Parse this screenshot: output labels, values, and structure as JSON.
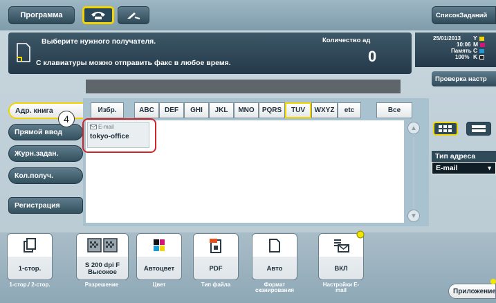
{
  "topbar": {
    "program_tab": "Программа",
    "job_list_tab": "СписокЗаданий"
  },
  "message": {
    "line1": "Выберите нужного получателя.",
    "line2": "С клавиатуры можно отправить факс в любое время.",
    "count_label": "Количество ад",
    "count_value": "0"
  },
  "status": {
    "date": "25/01/2013",
    "time": "10:06",
    "memory_label": "Память",
    "memory_value": "100%",
    "toner_letters": [
      "Y",
      "M",
      "C",
      "K"
    ],
    "toner_colors": [
      "#f2d400",
      "#d3157a",
      "#1c9ad6",
      "#222222"
    ]
  },
  "check_settings_button": "Проверка настр",
  "left_menu": {
    "address_book": "Адр. книга",
    "direct_input": "Прямой ввод",
    "job_log": "Журн.задан.",
    "multiple_dest": "Кол.получ.",
    "registration": "Регистрация"
  },
  "index_tabs": [
    "Избр.",
    "ABC",
    "DEF",
    "GHI",
    "JKL",
    "MNO",
    "PQRS",
    "TUV",
    "WXYZ",
    "etc",
    "Все"
  ],
  "destination": {
    "type": "E-mail",
    "name": "tokyo-office"
  },
  "callout_number": "4",
  "address_type": {
    "label": "Тип адреса",
    "value": "E-mail"
  },
  "functions": [
    {
      "value": "1-стор.",
      "label": "1-стор./ 2-стор."
    },
    {
      "value": "S 200 dpi F Высокое",
      "label": "Разрешение"
    },
    {
      "value": "Автоцвет",
      "label": "Цвет"
    },
    {
      "value": "PDF",
      "label": "Тип файла"
    },
    {
      "value": "Авто",
      "label": "Формат сканирования"
    },
    {
      "value": "ВКЛ",
      "label": "Настройки E-mail"
    }
  ],
  "application_button": "Приложение"
}
